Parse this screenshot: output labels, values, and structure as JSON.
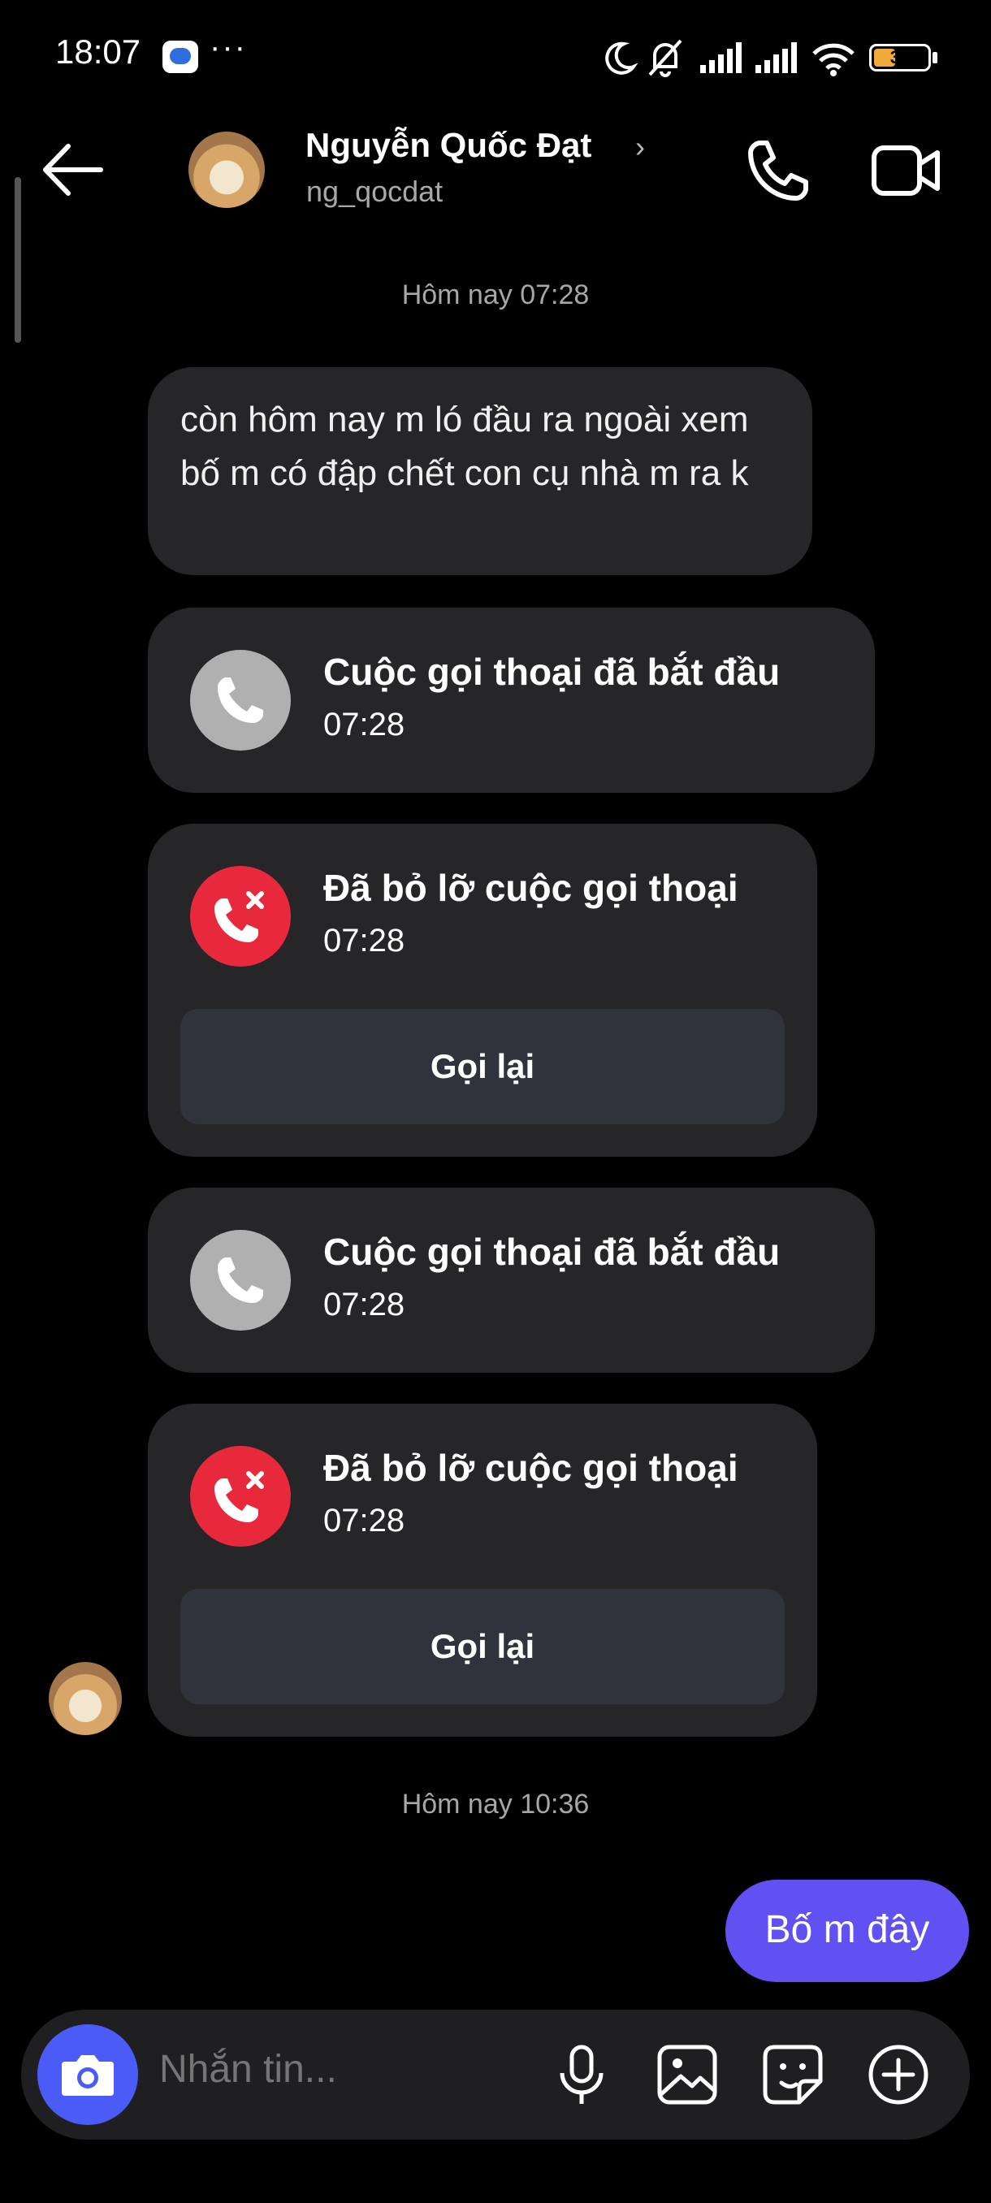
{
  "status_bar": {
    "time": "18:07",
    "dots": "···",
    "battery": "35",
    "icons": [
      "messenger-notification-icon",
      "moon-icon",
      "bell-off-icon",
      "signal-icon",
      "signal-icon",
      "wifi-icon",
      "battery-icon"
    ]
  },
  "header": {
    "name": "Nguyễn Quốc Đạt",
    "chevron": "›",
    "handle": "ng_qocdat"
  },
  "thread": {
    "timestamp_1": "Hôm nay 07:28",
    "message_1": "còn hôm nay m ló đầu ra ngoài xem bố m có đập chết con cụ nhà m ra k",
    "calls": [
      {
        "title": "Cuộc gọi thoại đã bắt đầu",
        "time": "07:28",
        "type": "started"
      },
      {
        "title": "Đã bỏ lỡ cuộc gọi thoại",
        "time": "07:28",
        "type": "missed",
        "action": "Gọi lại"
      },
      {
        "title": "Cuộc gọi thoại đã bắt đầu",
        "time": "07:28",
        "type": "started"
      },
      {
        "title": "Đã bỏ lỡ cuộc gọi thoại",
        "time": "07:28",
        "type": "missed",
        "action": "Gọi lại"
      }
    ],
    "timestamp_2": "Hôm nay 10:36",
    "outgoing_message": "Bố m đây"
  },
  "composer": {
    "placeholder": "Nhắn tin..."
  },
  "colors": {
    "background": "#000000",
    "bubble_incoming": "#262629",
    "bubble_outgoing": "#6150f2",
    "camera_button": "#4a5cf5",
    "missed_call": "#e8293b"
  }
}
